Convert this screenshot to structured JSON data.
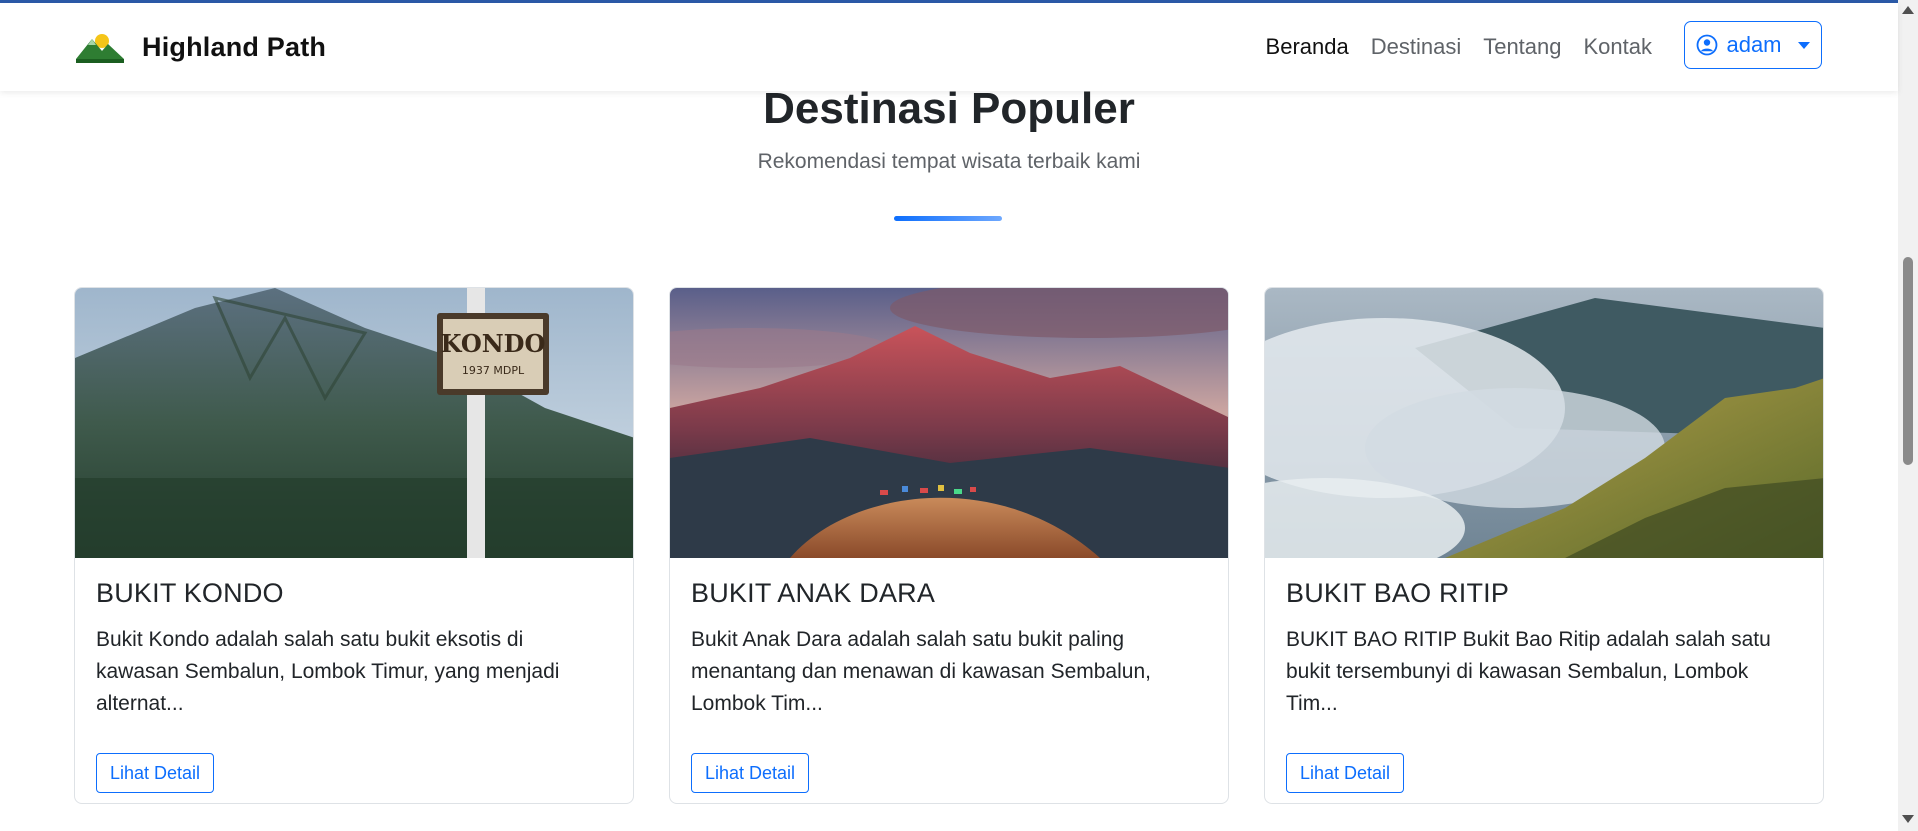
{
  "brand": {
    "name": "Highland Path",
    "logo_icon": "mountain-logo-icon"
  },
  "nav": {
    "links": [
      "Beranda",
      "Destinasi",
      "Tentang",
      "Kontak"
    ],
    "active_index": 0
  },
  "user_menu": {
    "username": "adam",
    "icon": "user-circle-icon"
  },
  "section": {
    "title": "Destinasi Populer",
    "subtitle": "Rekomendasi tempat wisata terbaik kami"
  },
  "cards": [
    {
      "title": "BUKIT KONDO",
      "description": "Bukit Kondo adalah salah satu bukit eksotis di kawasan Sembalun, Lombok Timur, yang menjadi alternat...",
      "button": "Lihat Detail",
      "image_label": "KONDO",
      "image_sublabel": "1937 MDPL"
    },
    {
      "title": "BUKIT ANAK DARA",
      "description": "Bukit Anak Dara adalah salah satu bukit paling menantang dan menawan di kawasan Sembalun, Lombok Tim...",
      "button": "Lihat Detail"
    },
    {
      "title": "BUKIT BAO RITIP",
      "description": "BUKIT BAO RITIP Bukit Bao Ritip adalah salah satu bukit tersembunyi di kawasan Sembalun, Lombok Tim...",
      "button": "Lihat Detail"
    }
  ],
  "colors": {
    "primary": "#0d6efd",
    "accent_bar": "#2b5aa8",
    "text": "#212529",
    "muted": "#5f6368"
  }
}
